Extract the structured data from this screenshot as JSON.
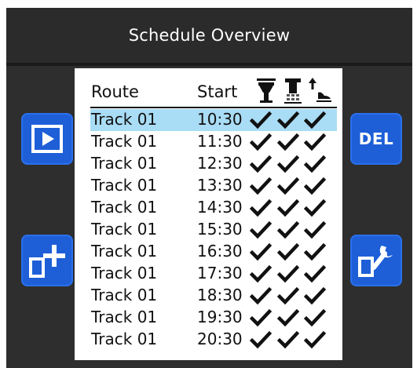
{
  "header": {
    "title": "Schedule Overview"
  },
  "table": {
    "columns": {
      "route": "Route",
      "start": "Start"
    },
    "header_icons": [
      "track-equipment-icon",
      "signal-station-icon",
      "lift-boot-icon"
    ],
    "rows": [
      {
        "route": "Track 01",
        "start": "10:30",
        "checks": [
          true,
          true,
          true
        ],
        "selected": true
      },
      {
        "route": "Track 01",
        "start": "11:30",
        "checks": [
          true,
          true,
          true
        ],
        "selected": false
      },
      {
        "route": "Track 01",
        "start": "12:30",
        "checks": [
          true,
          true,
          true
        ],
        "selected": false
      },
      {
        "route": "Track 01",
        "start": "13:30",
        "checks": [
          true,
          true,
          true
        ],
        "selected": false
      },
      {
        "route": "Track 01",
        "start": "14:30",
        "checks": [
          true,
          true,
          true
        ],
        "selected": false
      },
      {
        "route": "Track 01",
        "start": "15:30",
        "checks": [
          true,
          true,
          true
        ],
        "selected": false
      },
      {
        "route": "Track 01",
        "start": "16:30",
        "checks": [
          true,
          true,
          true
        ],
        "selected": false
      },
      {
        "route": "Track 01",
        "start": "17:30",
        "checks": [
          true,
          true,
          true
        ],
        "selected": false
      },
      {
        "route": "Track 01",
        "start": "18:30",
        "checks": [
          true,
          true,
          true
        ],
        "selected": false
      },
      {
        "route": "Track 01",
        "start": "19:30",
        "checks": [
          true,
          true,
          true
        ],
        "selected": false
      },
      {
        "route": "Track 01",
        "start": "20:30",
        "checks": [
          true,
          true,
          true
        ],
        "selected": false
      }
    ]
  },
  "buttons": {
    "play_icon": "play-icon",
    "add_icon": "add-icon",
    "delete_label": "DEL",
    "settings_icon": "wrench-icon"
  },
  "colors": {
    "button_blue": "#1e5fd8",
    "selected_row": "#a9dcf5",
    "header_bg": "#2b2b2b"
  }
}
